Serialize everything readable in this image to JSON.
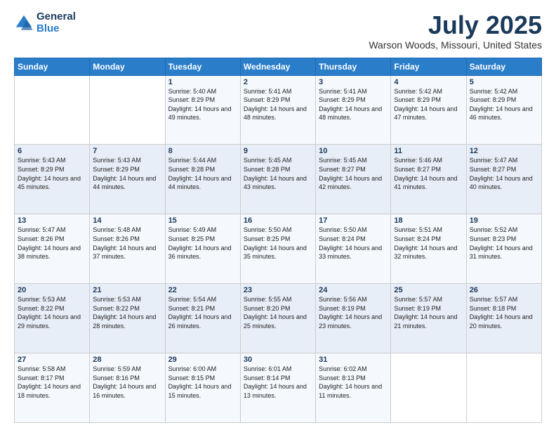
{
  "logo": {
    "general": "General",
    "blue": "Blue"
  },
  "title": "July 2025",
  "subtitle": "Warson Woods, Missouri, United States",
  "weekdays": [
    "Sunday",
    "Monday",
    "Tuesday",
    "Wednesday",
    "Thursday",
    "Friday",
    "Saturday"
  ],
  "weeks": [
    [
      {
        "day": "",
        "sunrise": "",
        "sunset": "",
        "daylight": ""
      },
      {
        "day": "",
        "sunrise": "",
        "sunset": "",
        "daylight": ""
      },
      {
        "day": "1",
        "sunrise": "Sunrise: 5:40 AM",
        "sunset": "Sunset: 8:29 PM",
        "daylight": "Daylight: 14 hours and 49 minutes."
      },
      {
        "day": "2",
        "sunrise": "Sunrise: 5:41 AM",
        "sunset": "Sunset: 8:29 PM",
        "daylight": "Daylight: 14 hours and 48 minutes."
      },
      {
        "day": "3",
        "sunrise": "Sunrise: 5:41 AM",
        "sunset": "Sunset: 8:29 PM",
        "daylight": "Daylight: 14 hours and 48 minutes."
      },
      {
        "day": "4",
        "sunrise": "Sunrise: 5:42 AM",
        "sunset": "Sunset: 8:29 PM",
        "daylight": "Daylight: 14 hours and 47 minutes."
      },
      {
        "day": "5",
        "sunrise": "Sunrise: 5:42 AM",
        "sunset": "Sunset: 8:29 PM",
        "daylight": "Daylight: 14 hours and 46 minutes."
      }
    ],
    [
      {
        "day": "6",
        "sunrise": "Sunrise: 5:43 AM",
        "sunset": "Sunset: 8:29 PM",
        "daylight": "Daylight: 14 hours and 45 minutes."
      },
      {
        "day": "7",
        "sunrise": "Sunrise: 5:43 AM",
        "sunset": "Sunset: 8:29 PM",
        "daylight": "Daylight: 14 hours and 44 minutes."
      },
      {
        "day": "8",
        "sunrise": "Sunrise: 5:44 AM",
        "sunset": "Sunset: 8:28 PM",
        "daylight": "Daylight: 14 hours and 44 minutes."
      },
      {
        "day": "9",
        "sunrise": "Sunrise: 5:45 AM",
        "sunset": "Sunset: 8:28 PM",
        "daylight": "Daylight: 14 hours and 43 minutes."
      },
      {
        "day": "10",
        "sunrise": "Sunrise: 5:45 AM",
        "sunset": "Sunset: 8:27 PM",
        "daylight": "Daylight: 14 hours and 42 minutes."
      },
      {
        "day": "11",
        "sunrise": "Sunrise: 5:46 AM",
        "sunset": "Sunset: 8:27 PM",
        "daylight": "Daylight: 14 hours and 41 minutes."
      },
      {
        "day": "12",
        "sunrise": "Sunrise: 5:47 AM",
        "sunset": "Sunset: 8:27 PM",
        "daylight": "Daylight: 14 hours and 40 minutes."
      }
    ],
    [
      {
        "day": "13",
        "sunrise": "Sunrise: 5:47 AM",
        "sunset": "Sunset: 8:26 PM",
        "daylight": "Daylight: 14 hours and 38 minutes."
      },
      {
        "day": "14",
        "sunrise": "Sunrise: 5:48 AM",
        "sunset": "Sunset: 8:26 PM",
        "daylight": "Daylight: 14 hours and 37 minutes."
      },
      {
        "day": "15",
        "sunrise": "Sunrise: 5:49 AM",
        "sunset": "Sunset: 8:25 PM",
        "daylight": "Daylight: 14 hours and 36 minutes."
      },
      {
        "day": "16",
        "sunrise": "Sunrise: 5:50 AM",
        "sunset": "Sunset: 8:25 PM",
        "daylight": "Daylight: 14 hours and 35 minutes."
      },
      {
        "day": "17",
        "sunrise": "Sunrise: 5:50 AM",
        "sunset": "Sunset: 8:24 PM",
        "daylight": "Daylight: 14 hours and 33 minutes."
      },
      {
        "day": "18",
        "sunrise": "Sunrise: 5:51 AM",
        "sunset": "Sunset: 8:24 PM",
        "daylight": "Daylight: 14 hours and 32 minutes."
      },
      {
        "day": "19",
        "sunrise": "Sunrise: 5:52 AM",
        "sunset": "Sunset: 8:23 PM",
        "daylight": "Daylight: 14 hours and 31 minutes."
      }
    ],
    [
      {
        "day": "20",
        "sunrise": "Sunrise: 5:53 AM",
        "sunset": "Sunset: 8:22 PM",
        "daylight": "Daylight: 14 hours and 29 minutes."
      },
      {
        "day": "21",
        "sunrise": "Sunrise: 5:53 AM",
        "sunset": "Sunset: 8:22 PM",
        "daylight": "Daylight: 14 hours and 28 minutes."
      },
      {
        "day": "22",
        "sunrise": "Sunrise: 5:54 AM",
        "sunset": "Sunset: 8:21 PM",
        "daylight": "Daylight: 14 hours and 26 minutes."
      },
      {
        "day": "23",
        "sunrise": "Sunrise: 5:55 AM",
        "sunset": "Sunset: 8:20 PM",
        "daylight": "Daylight: 14 hours and 25 minutes."
      },
      {
        "day": "24",
        "sunrise": "Sunrise: 5:56 AM",
        "sunset": "Sunset: 8:19 PM",
        "daylight": "Daylight: 14 hours and 23 minutes."
      },
      {
        "day": "25",
        "sunrise": "Sunrise: 5:57 AM",
        "sunset": "Sunset: 8:19 PM",
        "daylight": "Daylight: 14 hours and 21 minutes."
      },
      {
        "day": "26",
        "sunrise": "Sunrise: 5:57 AM",
        "sunset": "Sunset: 8:18 PM",
        "daylight": "Daylight: 14 hours and 20 minutes."
      }
    ],
    [
      {
        "day": "27",
        "sunrise": "Sunrise: 5:58 AM",
        "sunset": "Sunset: 8:17 PM",
        "daylight": "Daylight: 14 hours and 18 minutes."
      },
      {
        "day": "28",
        "sunrise": "Sunrise: 5:59 AM",
        "sunset": "Sunset: 8:16 PM",
        "daylight": "Daylight: 14 hours and 16 minutes."
      },
      {
        "day": "29",
        "sunrise": "Sunrise: 6:00 AM",
        "sunset": "Sunset: 8:15 PM",
        "daylight": "Daylight: 14 hours and 15 minutes."
      },
      {
        "day": "30",
        "sunrise": "Sunrise: 6:01 AM",
        "sunset": "Sunset: 8:14 PM",
        "daylight": "Daylight: 14 hours and 13 minutes."
      },
      {
        "day": "31",
        "sunrise": "Sunrise: 6:02 AM",
        "sunset": "Sunset: 8:13 PM",
        "daylight": "Daylight: 14 hours and 11 minutes."
      },
      {
        "day": "",
        "sunrise": "",
        "sunset": "",
        "daylight": ""
      },
      {
        "day": "",
        "sunrise": "",
        "sunset": "",
        "daylight": ""
      }
    ]
  ]
}
